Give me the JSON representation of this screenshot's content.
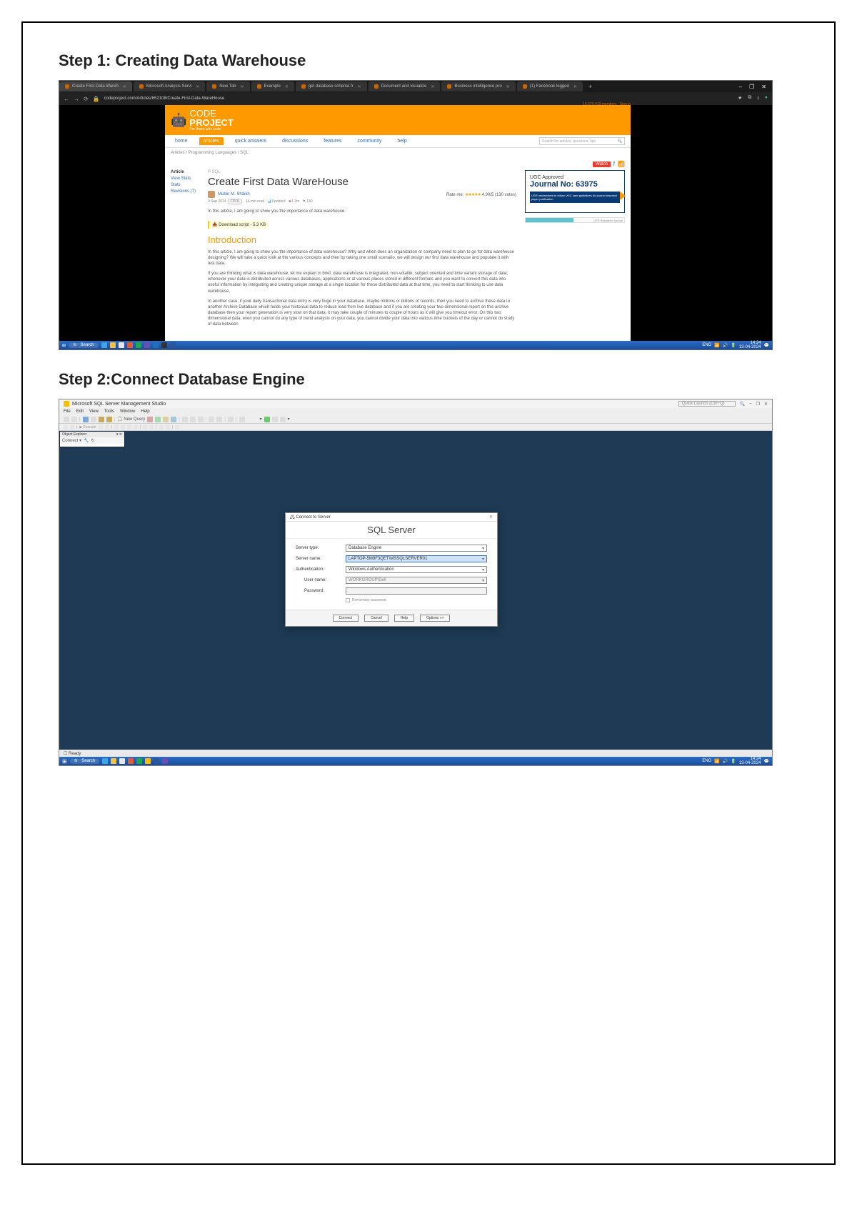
{
  "doc": {
    "step1_heading": "Step 1: Creating Data Warehouse",
    "step2_heading": "Step 2:Connect Database Engine"
  },
  "browser": {
    "tabs": [
      {
        "label": "Create First Data Wareh",
        "active": true
      },
      {
        "label": "Microsoft Analysis Servi",
        "active": false
      },
      {
        "label": "New Tab",
        "active": false
      },
      {
        "label": "Example",
        "active": false
      },
      {
        "label": "get database schema fr",
        "active": false
      },
      {
        "label": "Document and visualize",
        "active": false
      },
      {
        "label": "Business intelligence pro",
        "active": false
      },
      {
        "label": "(1) Facebook logged",
        "active": false
      }
    ],
    "url": "codeproject.com/Articles/652108/Create-First-Data-WareHouse",
    "window_controls": [
      "–",
      "❐",
      "✕"
    ],
    "addr_icons": {
      "star": "★",
      "plugin": "⧉",
      "download": "⭳",
      "user": "●"
    }
  },
  "codeproject": {
    "info_line": "15,679,413 members",
    "sign_line": "Sign in",
    "logo_top": "CODE",
    "logo_bottom": "PROJECT",
    "tagline": "For those who code",
    "nav": [
      "home",
      "articles",
      "quick answers",
      "discussions",
      "features",
      "community",
      "help"
    ],
    "nav_active_index": 1,
    "search_placeholder": "Search for articles, questions, tips",
    "breadcrumb": "Articles / Programming Languages / SQL",
    "left_menu": {
      "article": "Article",
      "view_stats": "View Stats",
      "stats": "Stats",
      "revisions": "Revisions (7)"
    },
    "article": {
      "tag": "P    SQL",
      "title": "Create First Data WareHouse",
      "author": "Mubin M. Shaikh",
      "rate_label": "Rate me:",
      "rate_score": "4.90/5 (130 votes)",
      "meta_date": "9 Sep 2014",
      "meta_lic": "CPOL",
      "meta_read": "14 min read",
      "meta_views": "Updated",
      "bookmark": "★",
      "bookmark_count": "1.3m",
      "kudos": "⚑ 130",
      "lede": "In this article, I am going to show you the importance of data warehouse.",
      "download": "Download script - 5.3 KB",
      "intro_h": "Introduction",
      "p1": "In this article, I am going to show you the importance of data warehouse? Why and when does an organization or company need to plan to go for data warehouse designing? We will take a quick look at the various concepts and then by taking one small scenario, we will design our first data warehouse and populate it with test data.",
      "p2": "If you are thinking what is data warehouse, let me explain in brief, data warehouse is integrated, non-volatile, subject oriented and time variant storage of data; whenever your data is distributed across various databases, applications or at various places stored in different formats and you want to convert this data into useful information by integrating and creating unique storage at a single location for these distributed data at that time, you need to start thinking to use data warehouse.",
      "p3": "In another case, if your daily transactional data entry is very huge in your database, maybe millions or billions of records, then you need to archive these data to another Archive Database which holds your historical data to reduce load from live database and if you are creating your two dimensional report on this archive database then your report generation is very slow on that data, it may take couple of minutes to couple of hours as it will give you timeout error. On this two dimensional data, even you cannot do any type of trend analysis on your data, you cannot divide your data into various time buckets of the day or cannot do study of data between"
    },
    "sidebar": {
      "watch_label": "Watch",
      "ad1_line1": "UGC Approved",
      "ad1_line2": "Journal No: 63975",
      "ad1_line3": "IJSR researchers to follow UGC care guidelines for journal research paper publication",
      "ad2_left": "",
      "ad2_right": "IJFR Research Journal"
    }
  },
  "taskbar": {
    "search": "Search",
    "icons": [
      "store",
      "explorer",
      "edge",
      "chrome",
      "vs",
      "settings",
      "word"
    ],
    "tray": {
      "eng": "ENG",
      "net": "🔊",
      "time": "14:24",
      "date": "13-04-2024"
    }
  },
  "ssms": {
    "title": "Microsoft SQL Server Management Studio",
    "quick_launch": "Quick Launch (Ctrl+Q)",
    "win_controls": [
      "–",
      "❐",
      "✕"
    ],
    "menu": [
      "File",
      "Edit",
      "View",
      "Tools",
      "Window",
      "Help"
    ],
    "toolbar": {
      "new_query": "New Query",
      "execute": "Execute"
    },
    "obj_explorer": {
      "title": "Object Explorer",
      "pin": "▾ ✕",
      "connect": "Connect ▾"
    },
    "dialog": {
      "title": "Connect to Server",
      "banner": "SQL Server",
      "rows": {
        "server_type": {
          "label": "Server type:",
          "value": "Database Engine"
        },
        "server_name": {
          "label": "Server name:",
          "value": "LAPTOP-5M9F3QET\\MSSQLSERVER01"
        },
        "auth": {
          "label": "Authentication:",
          "value": "Windows Authentication"
        },
        "user": {
          "label": "User name:",
          "value": "WORKGROUP\\Dell"
        },
        "pass": {
          "label": "Password:",
          "value": ""
        }
      },
      "remember": "Remember password",
      "buttons": {
        "connect": "Connect",
        "cancel": "Cancel",
        "help": "Help",
        "options": "Options >>"
      }
    },
    "status": "Ready",
    "taskbar": {
      "search": "Search",
      "icons": [
        "store",
        "explorer",
        "edge",
        "chrome",
        "ssms",
        "word"
      ],
      "tray": {
        "eng": "ENG",
        "net": "🔊",
        "time": "14:24",
        "date": "13-04-2024"
      }
    }
  }
}
